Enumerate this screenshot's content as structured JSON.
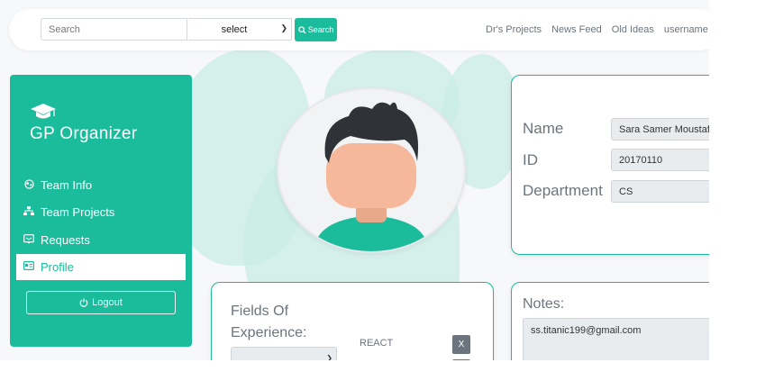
{
  "search": {
    "placeholder": "Search",
    "select_value": "select",
    "button_label": "Search"
  },
  "nav": {
    "links": [
      "Dr's Projects",
      "News Feed",
      "Old Ideas",
      "username"
    ]
  },
  "sidebar": {
    "brand": "GP Organizer",
    "items": [
      {
        "label": "Team Info",
        "icon": "globe-icon"
      },
      {
        "label": "Team Projects",
        "icon": "sitemap-icon"
      },
      {
        "label": "Requests",
        "icon": "inbox-icon"
      },
      {
        "label": "Profile",
        "icon": "id-card-icon",
        "active": true
      }
    ],
    "logout_label": "Logout"
  },
  "profile": {
    "name_label": "Name",
    "name_value": "Sara Samer Moustafa",
    "id_label": "ID",
    "id_value": "20170110",
    "department_label": "Department",
    "department_value": "CS"
  },
  "experience": {
    "title_line1": "Fields Of",
    "title_line2": "Experience:",
    "skill": "REACT",
    "remove_label": "X"
  },
  "notes": {
    "title": "Notes:",
    "text": "ss.titanic199@gmail.com"
  },
  "colors": {
    "accent": "#1abc9c",
    "blob": "#c9ece5"
  }
}
